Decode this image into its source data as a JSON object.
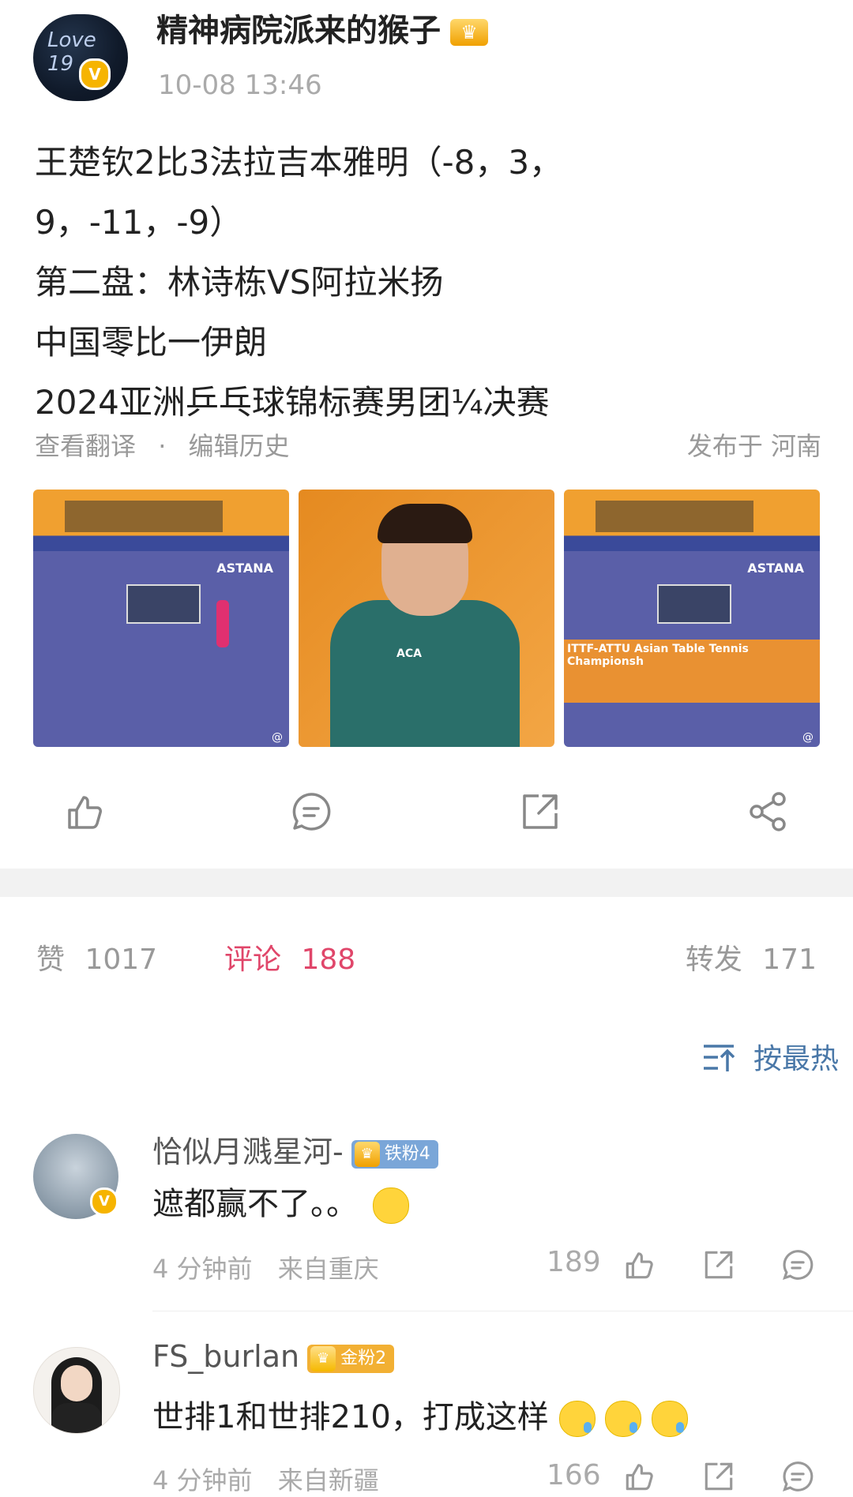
{
  "post": {
    "username": "精神病院派来的猴子",
    "timestamp": "10-08 13:46",
    "lines": [
      "王楚钦2比3法拉吉本雅明（-8，3，",
      "9，-11，-9）",
      "第二盘：林诗栋VS阿拉米扬",
      "中国零比一伊朗",
      "2024亚洲乒乓球锦标赛男团¼决赛"
    ],
    "translate_label": "查看翻译",
    "meta_sep": "·",
    "edit_history_label": "编辑历史",
    "location": "发布于 河南",
    "images": [
      {
        "kind": "court",
        "banner": "ASTANA"
      },
      {
        "kind": "player",
        "shirt_text": "ACA"
      },
      {
        "kind": "court-score",
        "banner": "ASTANA",
        "score_title": "ITTF-ATTU Asian Table Tennis Championsh"
      }
    ],
    "watermark": "@"
  },
  "actions": {
    "like_icon": "thumbs-up-icon",
    "comment_icon": "comment-icon",
    "repost_icon": "share-out-icon",
    "share_icon": "share-nodes-icon"
  },
  "stats": {
    "likes_label": "赞",
    "likes_count": "1017",
    "comments_label": "评论",
    "comments_count": "188",
    "reposts_label": "转发",
    "reposts_count": "171"
  },
  "sort": {
    "label": "按最热",
    "icon": "sort-icon"
  },
  "comments": [
    {
      "username": "恰似月溅星河-",
      "badge": "铁粉4",
      "text": "遮都赢不了。。",
      "emoji_count": 1,
      "time": "4 分钟前",
      "location": "来自重庆",
      "likes": "189"
    },
    {
      "username": "FS_burlan",
      "badge": "金粉2",
      "text": "世排1和世排210，打成这样",
      "emoji_count": 3,
      "time": "4 分钟前",
      "location": "来自新疆",
      "likes": "166"
    }
  ],
  "colors": {
    "accent_red": "#e0466a",
    "link_blue": "#4a78a8",
    "muted": "#999999",
    "vip_gold": "#f6b400"
  }
}
